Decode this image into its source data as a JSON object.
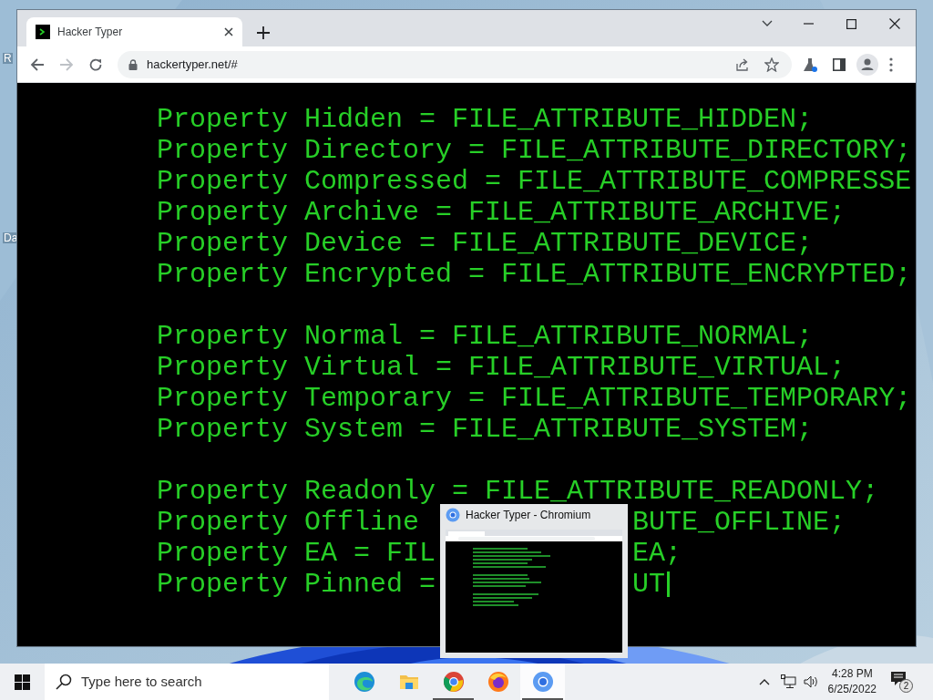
{
  "desktop": {
    "icon_labels": [
      "R",
      "Da"
    ]
  },
  "browser": {
    "tabs": [
      {
        "title": "Hacker Typer",
        "selected": true
      }
    ],
    "address": "hackertyper.net/#"
  },
  "terminal": {
    "groups": [
      {
        "lines": [
          {
            "text": "Property Hidden = FILE_ATTRIBUTE_HIDDEN;"
          },
          {
            "text": "Property Directory = FILE_ATTRIBUTE_DIRECTORY;"
          },
          {
            "text": "Property Compressed = FILE_ATTRIBUTE_COMPRESSE"
          },
          {
            "text": "Property Archive = FILE_ATTRIBUTE_ARCHIVE;"
          },
          {
            "text": "Property Device = FILE_ATTRIBUTE_DEVICE;"
          },
          {
            "text": "Property Encrypted = FILE_ATTRIBUTE_ENCRYPTED;"
          }
        ]
      },
      {
        "lines": [
          {
            "text": "Property Normal = FILE_ATTRIBUTE_NORMAL;"
          },
          {
            "text": "Property Virtual = FILE_ATTRIBUTE_VIRTUAL;"
          },
          {
            "text": "Property Temporary = FILE_ATTRIBUTE_TEMPORARY;"
          },
          {
            "text": "Property System = FILE_ATTRIBUTE_SYSTEM;"
          }
        ]
      },
      {
        "lines": [
          {
            "text": "Property Readonly = FILE_ATTRIBUTE_READONLY;"
          },
          {
            "text": "Property Offline",
            "text_after_preview": "BUTE_OFFLINE;"
          },
          {
            "text": "Property EA = FIL",
            "text_after_preview": "EA;"
          },
          {
            "text": "Property Pinned =",
            "text_after_preview": "UT"
          }
        ]
      }
    ],
    "cursor_visible": true
  },
  "window_preview": {
    "title": "Hacker Typer - Chromium"
  },
  "taskbar": {
    "search_placeholder": "Type here to search",
    "apps": [
      {
        "kind": "edge",
        "running": false,
        "selected": false
      },
      {
        "kind": "files",
        "running": false,
        "selected": false
      },
      {
        "kind": "chrome",
        "running": true,
        "selected": false
      },
      {
        "kind": "firefox",
        "running": false,
        "selected": false
      },
      {
        "kind": "chromium",
        "running": true,
        "selected": true
      }
    ],
    "time": "4:28 PM",
    "date": "6/25/2022",
    "notifications": "2"
  }
}
